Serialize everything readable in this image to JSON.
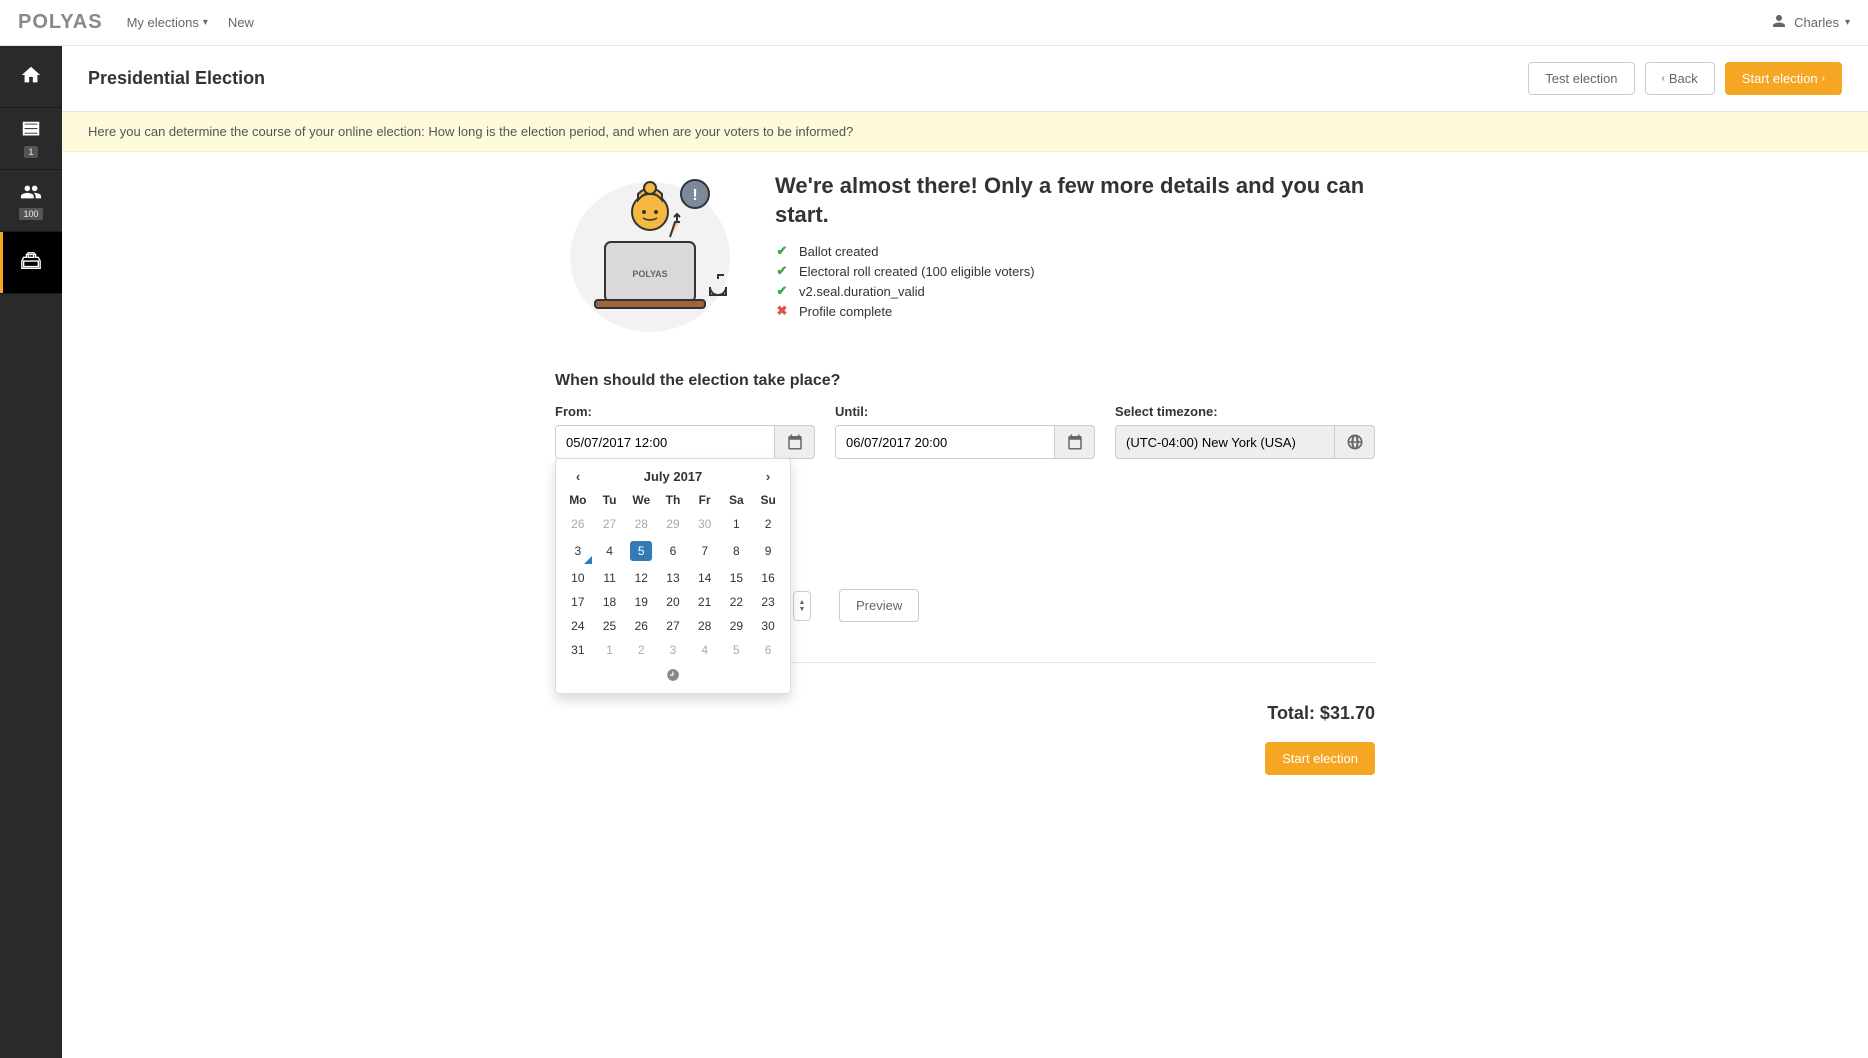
{
  "brand": "POLYAS",
  "topnav": {
    "my_elections": "My elections",
    "new": "New"
  },
  "user": {
    "name": "Charles"
  },
  "sidebar": {
    "ballot_badge": "1",
    "voters_badge": "100"
  },
  "page": {
    "title": "Presidential Election",
    "btn_test": "Test election",
    "btn_back": "Back",
    "btn_start": "Start election"
  },
  "info": "Here you can determine the course of your online election: How long is the election period, and when are your voters to be informed?",
  "hero": {
    "heading": "We're almost there! Only a few more details and you can start.",
    "items": [
      {
        "label": "Ballot created",
        "ok": true
      },
      {
        "label": "Electoral roll created (100 eligible voters)",
        "ok": true
      },
      {
        "label": "v2.seal.duration_valid",
        "ok": true
      },
      {
        "label": "Profile complete",
        "ok": false
      }
    ]
  },
  "schedule": {
    "title": "When should the election take place?",
    "from_label": "From:",
    "until_label": "Until:",
    "tz_label": "Select timezone:",
    "from_value": "05/07/2017 12:00",
    "until_value": "06/07/2017 20:00",
    "tz_value": "(UTC-04:00) New York (USA)"
  },
  "datepicker": {
    "month": "July 2017",
    "dow": [
      "Mo",
      "Tu",
      "We",
      "Th",
      "Fr",
      "Sa",
      "Su"
    ],
    "weeks": [
      [
        {
          "d": 26,
          "m": true
        },
        {
          "d": 27,
          "m": true
        },
        {
          "d": 28,
          "m": true
        },
        {
          "d": 29,
          "m": true
        },
        {
          "d": 30,
          "m": true
        },
        {
          "d": 1
        },
        {
          "d": 2
        }
      ],
      [
        {
          "d": 3,
          "t": true
        },
        {
          "d": 4
        },
        {
          "d": 5,
          "s": true
        },
        {
          "d": 6
        },
        {
          "d": 7
        },
        {
          "d": 8
        },
        {
          "d": 9
        }
      ],
      [
        {
          "d": 10
        },
        {
          "d": 11
        },
        {
          "d": 12
        },
        {
          "d": 13
        },
        {
          "d": 14
        },
        {
          "d": 15
        },
        {
          "d": 16
        }
      ],
      [
        {
          "d": 17
        },
        {
          "d": 18
        },
        {
          "d": 19
        },
        {
          "d": 20
        },
        {
          "d": 21
        },
        {
          "d": 22
        },
        {
          "d": 23
        }
      ],
      [
        {
          "d": 24
        },
        {
          "d": 25
        },
        {
          "d": 26
        },
        {
          "d": 27
        },
        {
          "d": 28
        },
        {
          "d": 29
        },
        {
          "d": 30
        }
      ],
      [
        {
          "d": 31
        },
        {
          "d": 1,
          "m": true
        },
        {
          "d": 2,
          "m": true
        },
        {
          "d": 3,
          "m": true
        },
        {
          "d": 4,
          "m": true
        },
        {
          "d": 5,
          "m": true
        },
        {
          "d": 6,
          "m": true
        }
      ]
    ]
  },
  "preview_btn": "Preview",
  "totals": {
    "label": "Total: $31.70",
    "start": "Start election"
  }
}
